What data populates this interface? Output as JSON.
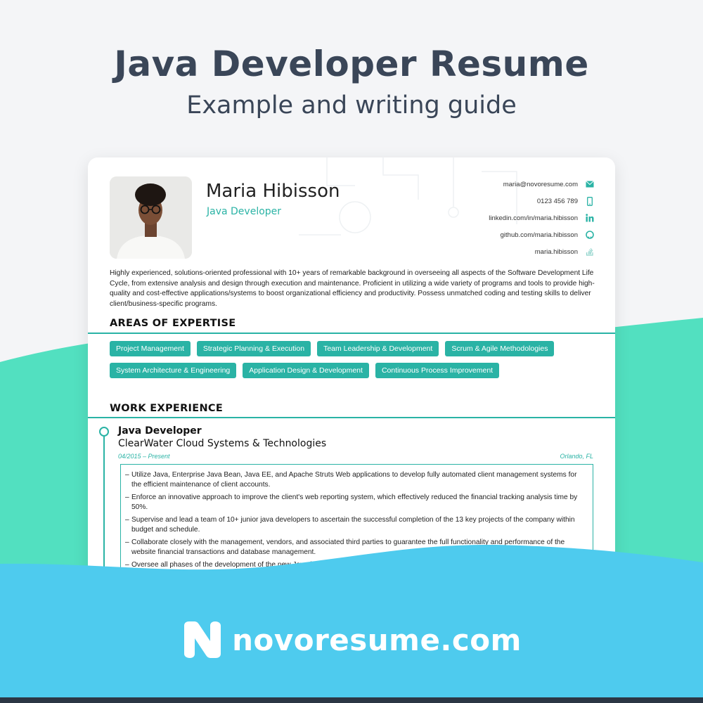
{
  "header": {
    "title": "Java Developer Resume",
    "subtitle": "Example and writing guide"
  },
  "resume": {
    "name": "Maria Hibisson",
    "role": "Java Developer",
    "contacts": [
      {
        "text": "maria@novoresume.com",
        "icon": "mail-icon"
      },
      {
        "text": "0123 456 789",
        "icon": "phone-icon"
      },
      {
        "text": "linkedin.com/in/maria.hibisson",
        "icon": "linkedin-icon"
      },
      {
        "text": "github.com/maria.hibisson",
        "icon": "github-icon"
      },
      {
        "text": "maria.hibisson",
        "icon": "stackoverflow-icon"
      }
    ],
    "summary": "Highly experienced, solutions-oriented professional with 10+ years of remarkable background in overseeing all aspects of the Software Development Life Cycle, from extensive analysis and design through execution and maintenance. Proficient in utilizing a wide variety of programs and tools to provide high-quality and cost-effective applications/systems to boost organizational efficiency and productivity. Possess unmatched coding and testing skills to deliver client/business-specific programs.",
    "expertise_heading": "AREAS OF EXPERTISE",
    "expertise_row1": [
      "Project Management",
      "Strategic Planning & Execution",
      "Team Leadership & Development",
      "Scrum & Agile Methodologies"
    ],
    "expertise_row2": [
      "System Architecture & Engineering",
      "Application Design & Development",
      "Continuous Process Improvement"
    ],
    "work_heading": "WORK EXPERIENCE",
    "job": {
      "title": "Java Developer",
      "company": "ClearWater Cloud Systems & Technologies",
      "dates": "04/2015 – Present",
      "location": "Orlando, FL",
      "bullets": [
        "Utilize Java, Enterprise Java Bean, Java EE, and Apache Struts Web applications to develop fully automated client management systems for the efficient maintenance of client accounts.",
        "Enforce an innovative approach to improve the client's web reporting system, which effectively reduced the financial tracking analysis time by 50%.",
        "Supervise and lead a team of 10+ junior java developers to ascertain the successful completion of the 13 key projects of the company within budget and schedule.",
        "Collaborate closely with the management, vendors, and associated third parties to guarantee the full functionality and performance of the website financial transactions and database management.",
        "Oversee all phases of the development of the new Java-based applications from conceptualization and design through deployment."
      ]
    }
  },
  "brand": {
    "text": "novoresume.com"
  },
  "colors": {
    "teal": "#2ab3a5",
    "mint_wave": "#4fe0bf",
    "sky_wave": "#4ecbee",
    "title": "#3a4658"
  }
}
